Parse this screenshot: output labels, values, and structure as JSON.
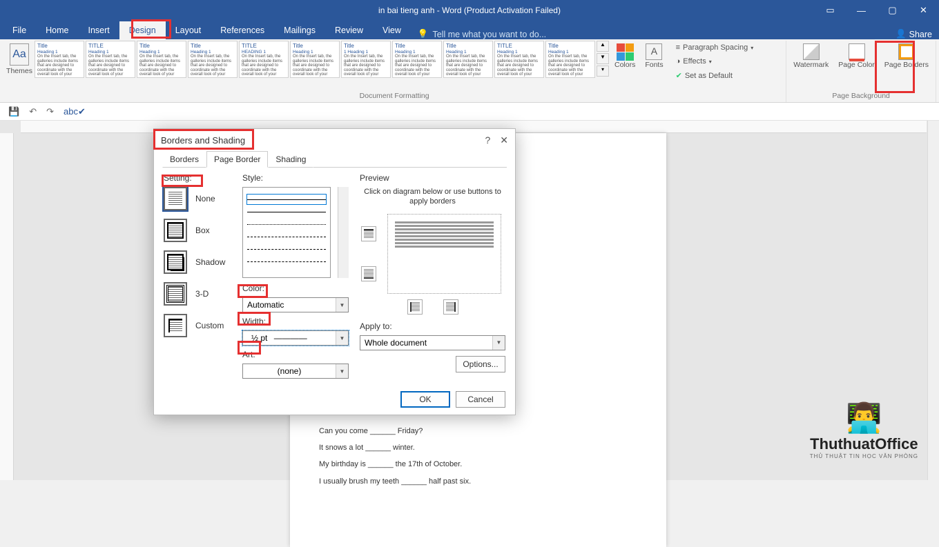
{
  "app": {
    "title": "in bai tieng anh - Word (Product Activation Failed)",
    "share": "Share"
  },
  "tabs": {
    "file": "File",
    "home": "Home",
    "insert": "Insert",
    "design": "Design",
    "layout": "Layout",
    "references": "References",
    "mailings": "Mailings",
    "review": "Review",
    "view": "View",
    "tellme": "Tell me what you want to do..."
  },
  "ribbon": {
    "themes": "Themes",
    "colors": "Colors",
    "fonts": "Fonts",
    "para_spacing": "Paragraph Spacing",
    "effects": "Effects",
    "set_default": "Set as Default",
    "doc_formatting": "Document Formatting",
    "page_bg": "Page Background",
    "watermark": "Watermark",
    "page_color": "Page Color",
    "page_borders": "Page Borders"
  },
  "dialog": {
    "title": "Borders and Shading",
    "tabs": {
      "borders": "Borders",
      "page_border": "Page Border",
      "shading": "Shading"
    },
    "setting": "Setting:",
    "style": "Style:",
    "preview": "Preview",
    "preview_hint": "Click on diagram below or use buttons to apply borders",
    "settings": {
      "none": "None",
      "box": "Box",
      "shadow": "Shadow",
      "threed": "3-D",
      "custom": "Custom"
    },
    "color": "Color:",
    "color_val": "Automatic",
    "width": "Width:",
    "width_val": "½ pt",
    "art": "Art:",
    "art_val": "(none)",
    "apply_to": "Apply to:",
    "apply_to_val": "Whole document",
    "options": "Options...",
    "ok": "OK",
    "cancel": "Cancel"
  },
  "doc_lines": [
    "Can you come ______ Friday?",
    "It snows a lot ______ winter.",
    "My birthday is ______ the 17th of October.",
    "I usually brush my teeth ______ half past six."
  ],
  "watermark": {
    "name": "ThuthuatOffice",
    "sub": "THỦ THUẬT TIN HỌC VĂN PHÒNG"
  }
}
